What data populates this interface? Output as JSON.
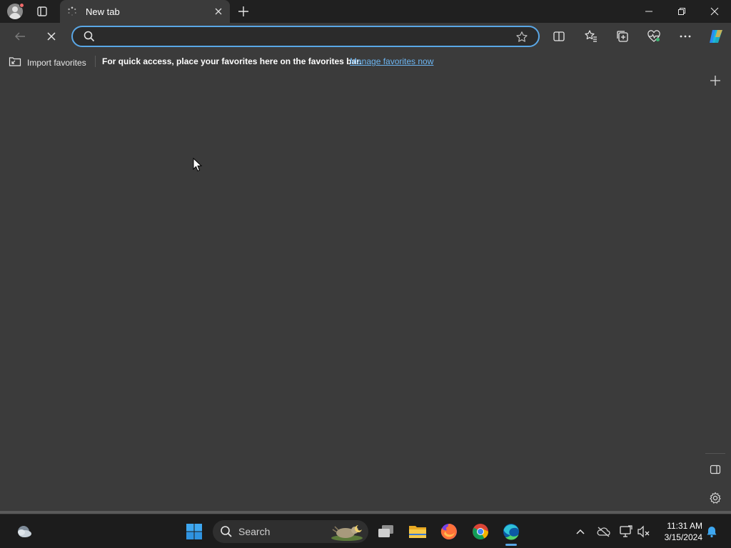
{
  "browser": {
    "tab": {
      "title": "New tab"
    },
    "omnibox": {
      "value": "",
      "placeholder": ""
    },
    "favorites_bar": {
      "import_label": "Import favorites",
      "message": "For quick access, place your favorites here on the favorites bar.",
      "link": "Manage favorites now"
    }
  },
  "taskbar": {
    "search_label": "Search",
    "time": "11:31 AM",
    "date": "3/15/2024"
  },
  "colors": {
    "accent": "#5aa7e6",
    "link": "#6cb4f0",
    "page_bg": "#3b3b3b",
    "chrome_bg": "#202020"
  }
}
